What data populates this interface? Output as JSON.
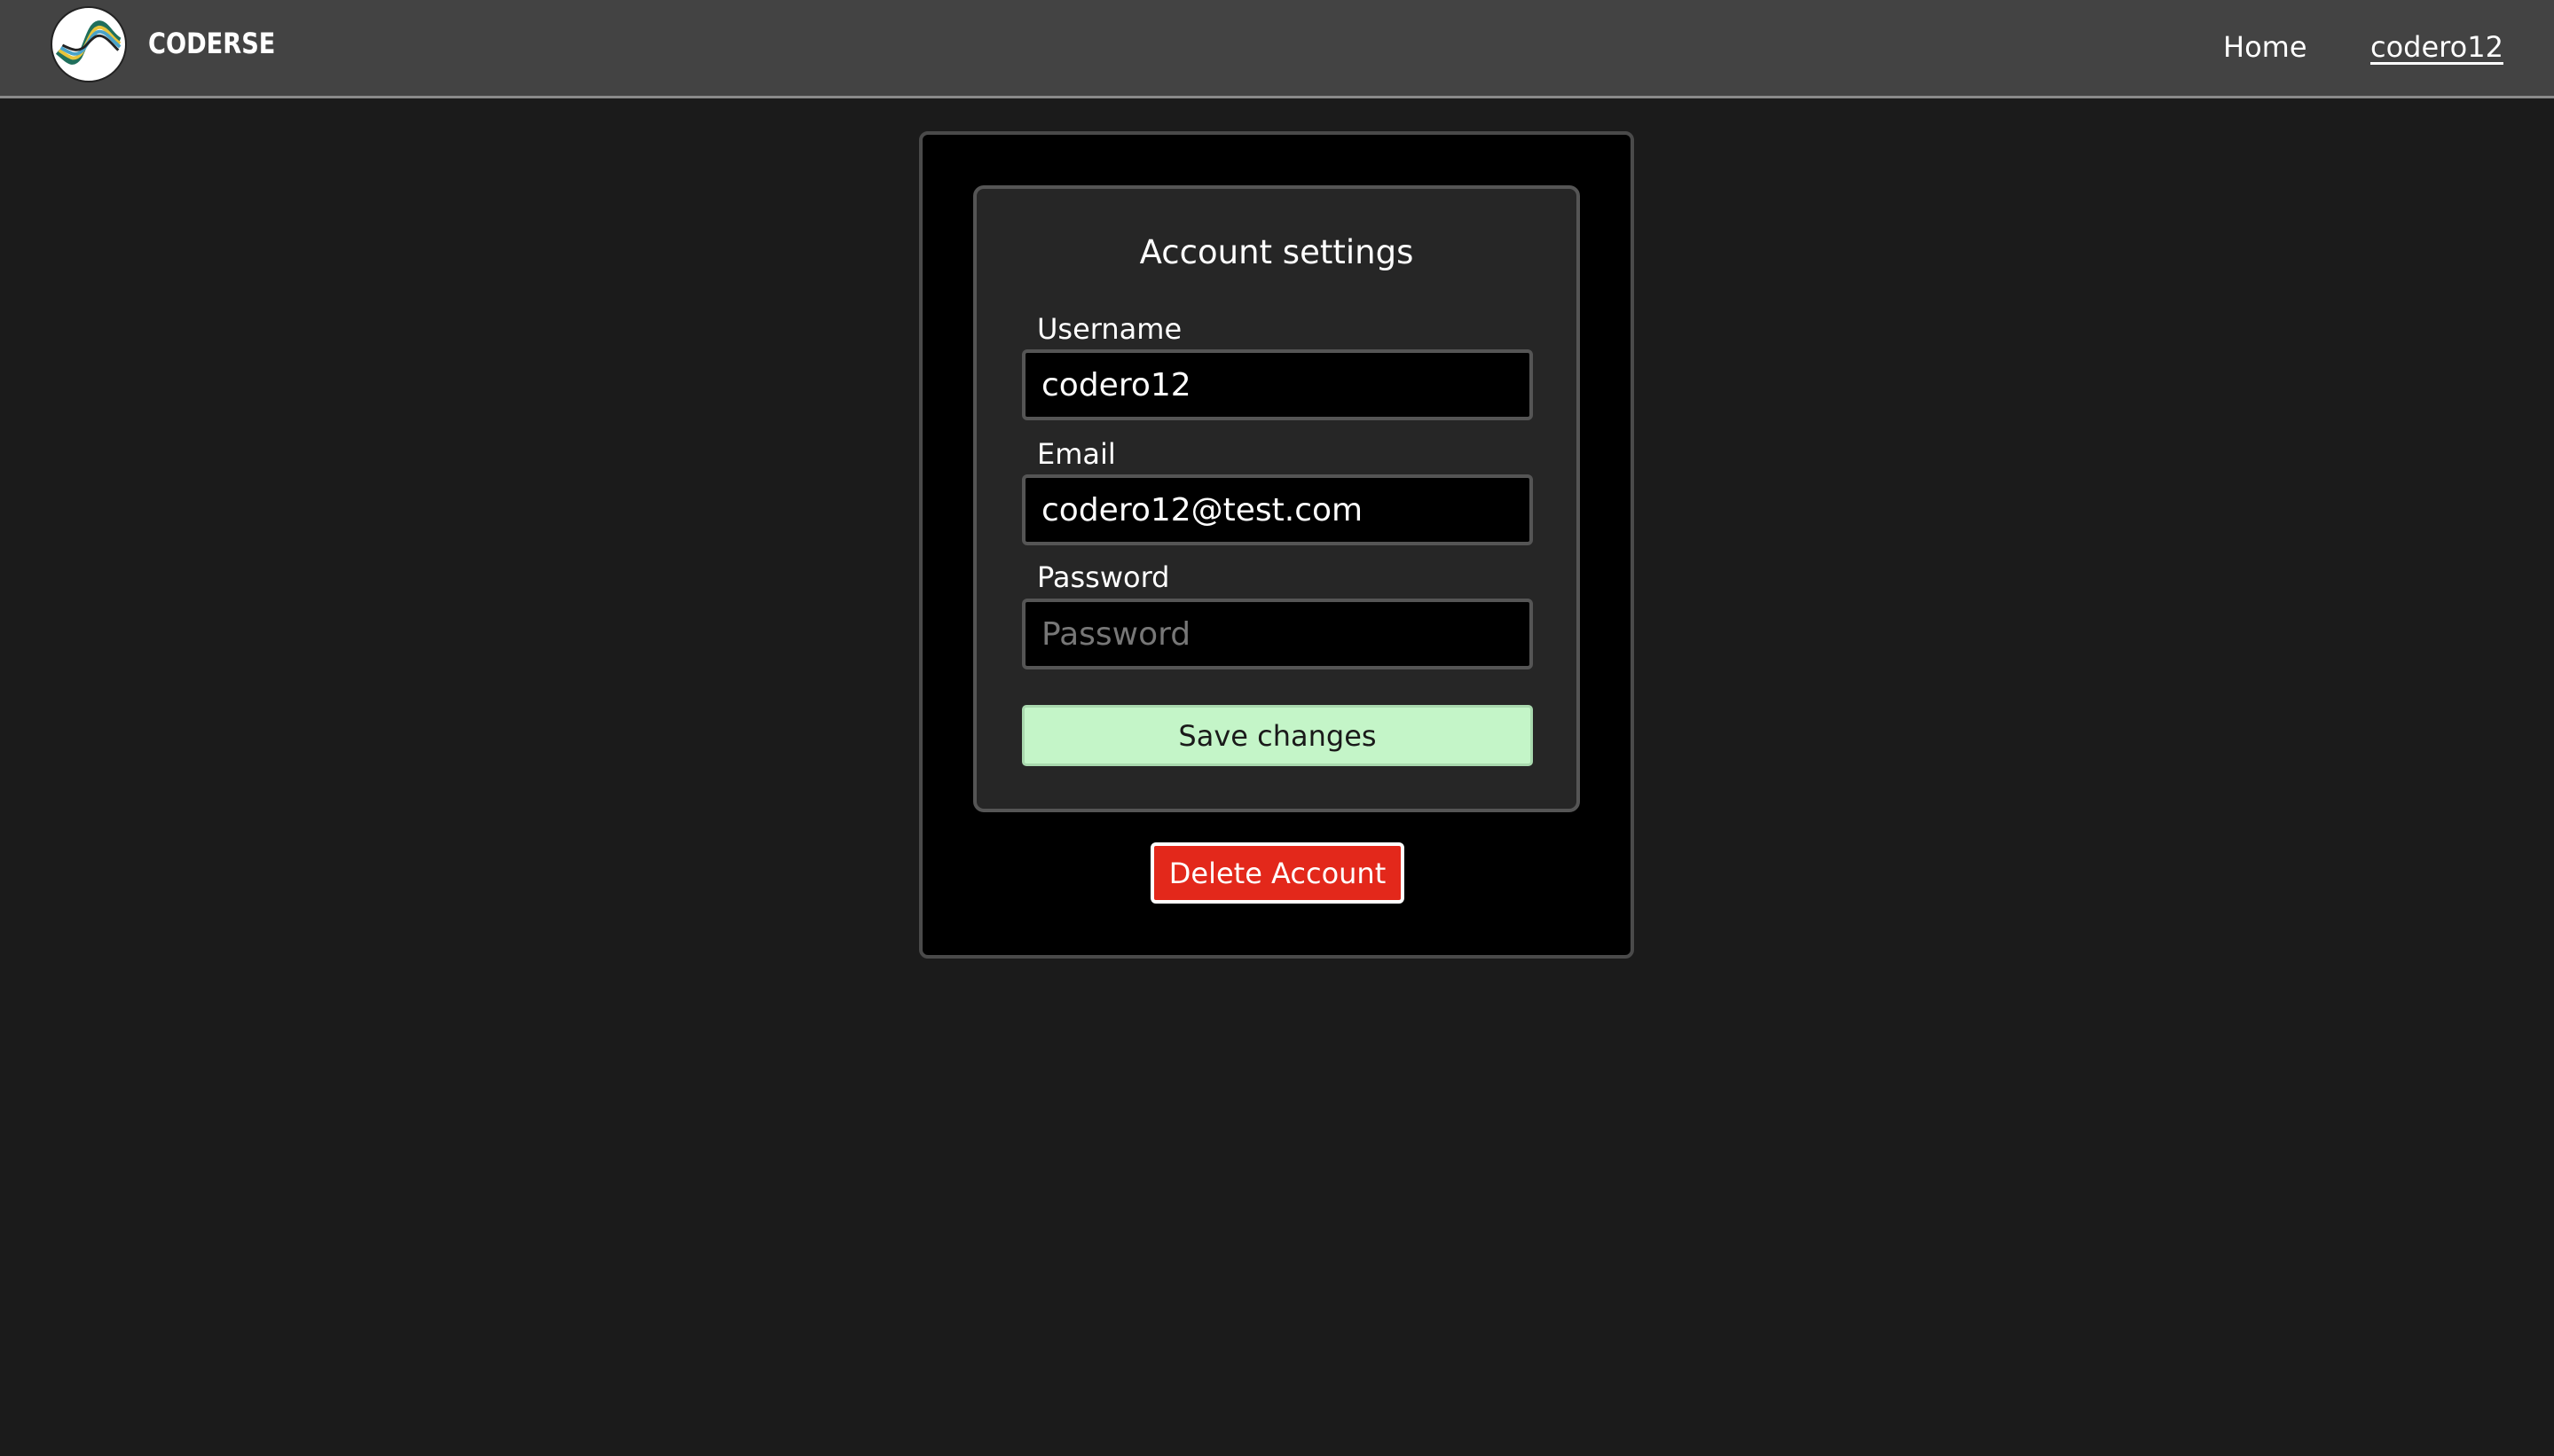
{
  "nav": {
    "brand": "CODERSE",
    "home_label": "Home",
    "user_label": "codero12"
  },
  "settings": {
    "title": "Account settings",
    "username_label": "Username",
    "username_value": "codero12",
    "email_label": "Email",
    "email_value": "codero12@test.com",
    "password_label": "Password",
    "password_value": "",
    "password_placeholder": "Password",
    "save_label": "Save changes",
    "delete_label": "Delete Account"
  },
  "colors": {
    "background": "#1b1b1b",
    "navbar": "#434343",
    "save_button": "#c4f5c8",
    "delete_button": "#e3281b"
  },
  "icons": {
    "logo": "wave-logo-icon"
  }
}
